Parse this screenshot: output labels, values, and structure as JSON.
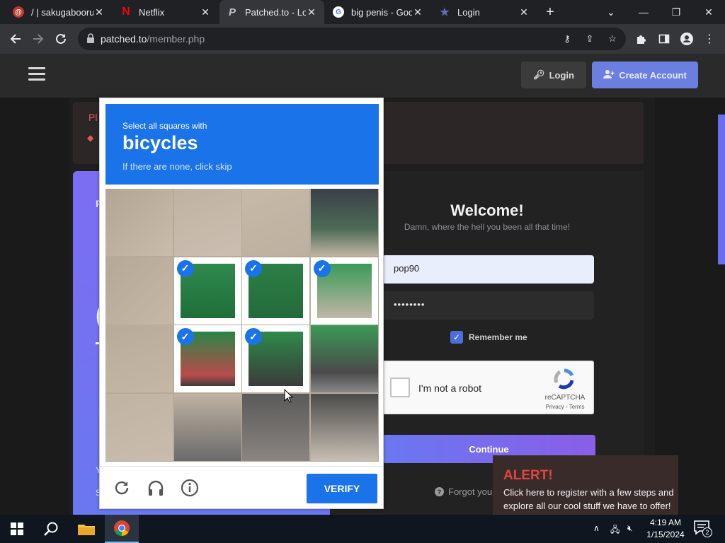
{
  "browser": {
    "tabs": [
      {
        "title": "/ | sakugabooru",
        "fav_color": "#c0392b",
        "fav_glyph": "@",
        "active": false
      },
      {
        "title": "Netflix",
        "fav_color": "#e50914",
        "fav_glyph": "N",
        "active": false
      },
      {
        "title": "Patched.to - Log",
        "fav_color": "#bdc1c6",
        "fav_glyph": "P",
        "active": true
      },
      {
        "title": "big penis - Goog",
        "fav_color": "#4285f4",
        "fav_glyph": "G",
        "active": false
      },
      {
        "title": "Login",
        "fav_color": "#3f51b5",
        "fav_glyph": "★",
        "active": false
      }
    ],
    "url_domain": "patched.to",
    "url_path": "/member.php"
  },
  "site": {
    "login_label": "Login",
    "create_account_label": "Create Account",
    "notice_text": "Pl",
    "notice_bullet": "◆",
    "promo_text": "P",
    "promo_big": "(",
    "promo_footer_y": "Y",
    "promo_footer_s": "S",
    "welcome": "Welcome!",
    "welcome_sub": "Damn, where the hell you been all that time!",
    "username_value": "pop90",
    "password_value": "••••••••",
    "remember_label": "Remember me",
    "remember_checked": true,
    "captcha_label": "I'm not a robot",
    "captcha_brand": "reCAPTCHA",
    "captcha_terms": "Privacy - Terms",
    "continue_label": "Continue",
    "forgot_label": "Forgot your"
  },
  "alert": {
    "title": "ALERT!",
    "body": "Click here to register with a few steps and explore all our cool stuff we have to offer!"
  },
  "challenge": {
    "line1": "Select all squares with",
    "keyword": "bicycles",
    "line3": "If there are none, click skip",
    "verify_label": "VERIFY",
    "selected_tiles": [
      5,
      6,
      7,
      9,
      10
    ],
    "tile_count": 16
  },
  "taskbar": {
    "time": "4:19 AM",
    "date": "1/15/2024",
    "notifications": "2"
  }
}
